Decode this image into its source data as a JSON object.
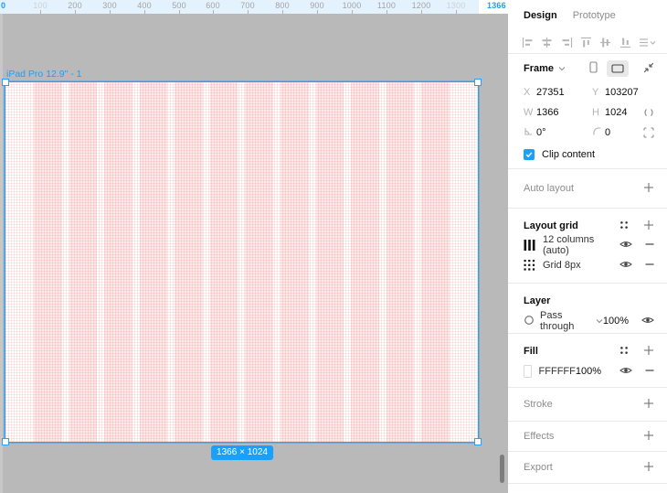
{
  "colors": {
    "accent": "#18a0fb",
    "canvas_bg": "#b9b9b9",
    "grid_pink": "#eb5757",
    "fill_swatch_hex": "#FFFFFF"
  },
  "canvas": {
    "ruler": {
      "origin": "0",
      "ticks": [
        "100",
        "200",
        "300",
        "400",
        "500",
        "600",
        "700",
        "800",
        "900",
        "1000",
        "1100",
        "1200",
        "1300"
      ],
      "end_label": "1366"
    },
    "frame": {
      "title": "iPad Pro 12.9\" - 1",
      "size_badge": "1366 × 1024"
    }
  },
  "panel": {
    "tabs": {
      "design": "Design",
      "prototype": "Prototype"
    },
    "frame": {
      "title": "Frame",
      "x_label": "X",
      "x_value": "27351",
      "y_label": "Y",
      "y_value": "103207",
      "w_label": "W",
      "w_value": "1366",
      "h_label": "H",
      "h_value": "1024",
      "rotation_value": "0°",
      "radius_value": "0",
      "clip_label": "Clip content"
    },
    "auto_layout": {
      "title": "Auto layout"
    },
    "layout_grid": {
      "title": "Layout grid",
      "rows": [
        {
          "label": "12 columns (auto)"
        },
        {
          "label": "Grid 8px"
        }
      ]
    },
    "layer": {
      "title": "Layer",
      "blend_mode": "Pass through",
      "opacity": "100%"
    },
    "fill": {
      "title": "Fill",
      "rows": [
        {
          "hex": "FFFFFF",
          "opacity": "100%"
        }
      ]
    },
    "stroke": {
      "title": "Stroke"
    },
    "effects": {
      "title": "Effects"
    },
    "export": {
      "title": "Export"
    }
  }
}
